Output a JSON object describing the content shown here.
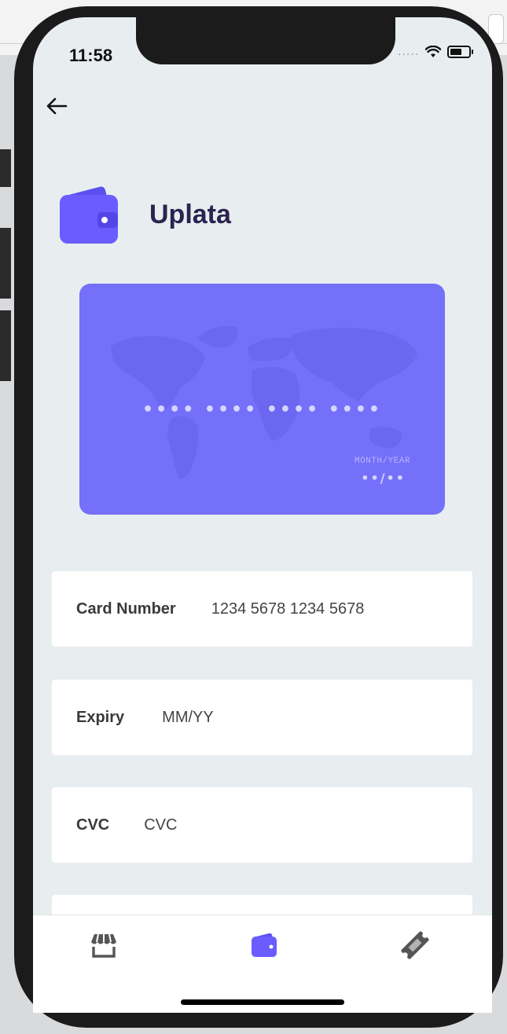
{
  "status_bar": {
    "time": "11:58",
    "signal": "....."
  },
  "header": {
    "title": "Uplata",
    "icon": "wallet-icon"
  },
  "card_preview": {
    "number_mask": "•••• •••• •••• ••••",
    "expiry_label": "MONTH/YEAR",
    "expiry_mask": "••/••",
    "color": "#7470f9"
  },
  "form": {
    "card_number": {
      "label": "Card Number",
      "value": "1234 5678 1234 5678"
    },
    "expiry": {
      "label": "Expiry",
      "placeholder": "MM/YY"
    },
    "cvc": {
      "label": "CVC",
      "placeholder": "CVC"
    }
  },
  "tab_bar": {
    "tabs": [
      {
        "icon": "store-icon",
        "active": false
      },
      {
        "icon": "wallet-icon",
        "active": true
      },
      {
        "icon": "ticket-icon",
        "active": false
      }
    ],
    "active_color": "#6a5cff",
    "inactive_color": "#555555"
  }
}
